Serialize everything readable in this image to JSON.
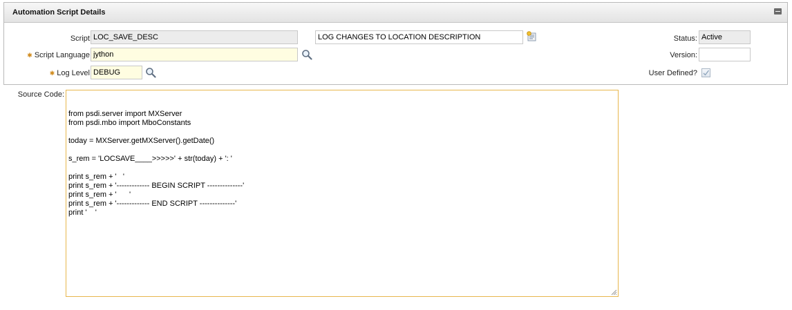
{
  "section": {
    "title": "Automation Script Details"
  },
  "form": {
    "script": {
      "label": "Script:",
      "value": "LOC_SAVE_DESC"
    },
    "description": {
      "value": "LOG CHANGES TO LOCATION DESCRIPTION"
    },
    "script_language": {
      "label": "Script Language:",
      "value": "jython"
    },
    "log_level": {
      "label": "Log Level:",
      "value": "DEBUG"
    },
    "status": {
      "label": "Status:",
      "value": "Active"
    },
    "version": {
      "label": "Version:",
      "value": ""
    },
    "user_defined": {
      "label": "User Defined?",
      "checked": true
    },
    "source_code": {
      "label": "Source Code:",
      "lines": [
        "from psdi.server import MXServer",
        "from psdi.mbo import MboConstants",
        "",
        "today = MXServer.getMXServer().getDate()",
        "",
        "s_rem = 'LOCSAVE____>>>>>' + str(today) + ': '",
        "",
        "print s_rem + '   '",
        "print s_rem + '------------- BEGIN SCRIPT --------------'",
        "print s_rem + '      '",
        "print s_rem + '------------- END SCRIPT --------------'",
        "print '    '"
      ]
    }
  },
  "icons": {
    "lookup": "magnifier-icon",
    "long_description": "long-description-icon",
    "collapse": "collapse-section-icon",
    "required": "required-asterisk"
  },
  "colors": {
    "required_marker": "#d08a1c",
    "focus_border": "#e8b64c",
    "readonly_bg": "#ececec",
    "editable_bg": "#fffde1"
  }
}
